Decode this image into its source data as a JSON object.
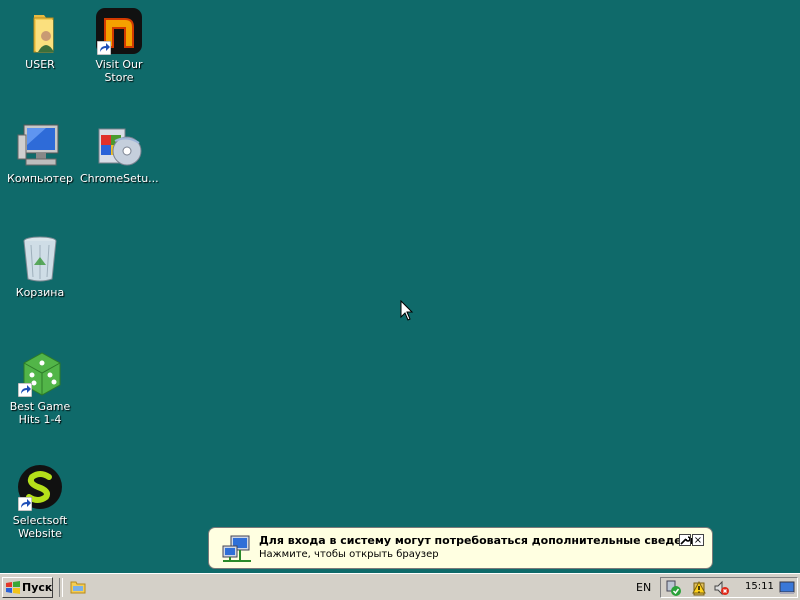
{
  "desktop": {
    "icons": [
      {
        "label": "USER",
        "icon": "user-folder-icon"
      },
      {
        "label": "Visit Our Store",
        "icon": "store-logo-icon"
      },
      {
        "label": "Компьютер",
        "icon": "computer-icon"
      },
      {
        "label": "ChromeSetu...",
        "icon": "installer-icon"
      },
      {
        "label": "Корзина",
        "icon": "recycle-bin-icon"
      },
      {
        "label": "Best Game Hits 1-4",
        "icon": "green-dice-icon"
      },
      {
        "label": "Selectsoft Website",
        "icon": "selectsoft-logo-icon"
      }
    ],
    "background_color": "#0f6a6a"
  },
  "balloon": {
    "title": "Для входа в систему могут потребоваться дополнительные сведения",
    "text": "Нажмите, чтобы открыть браузер",
    "icon": "network-icon",
    "options_icon": "wrench-icon",
    "close_glyph": "×"
  },
  "taskbar": {
    "start_label": "Пуск",
    "language": "EN",
    "clock": "15:11",
    "tray_icons": [
      "network-check-icon",
      "security-warning-icon",
      "volume-muted-icon",
      "desktop-icon"
    ]
  }
}
